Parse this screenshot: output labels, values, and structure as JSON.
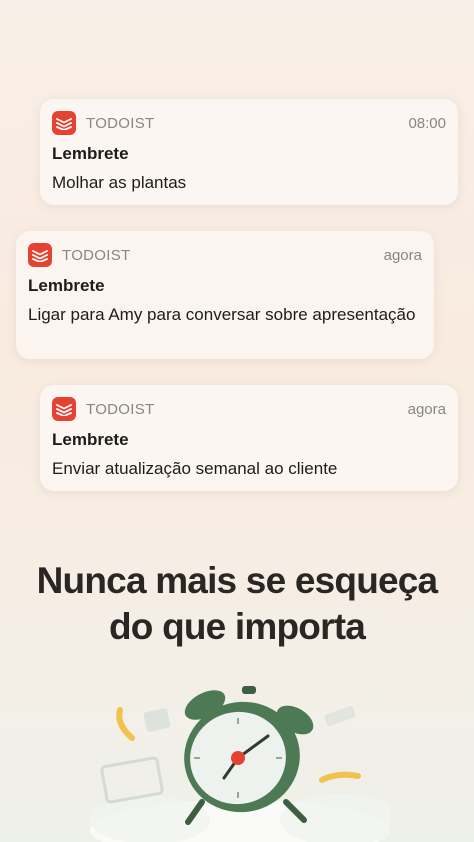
{
  "notifications": [
    {
      "app": "TODOIST",
      "time": "08:00",
      "title": "Lembrete",
      "body": "Molhar as plantas"
    },
    {
      "app": "TODOIST",
      "time": "agora",
      "title": "Lembrete",
      "body": "Ligar para Amy para conversar sobre apresentação"
    },
    {
      "app": "TODOIST",
      "time": "agora",
      "title": "Lembrete",
      "body": "Enviar atualização semanal ao cliente"
    }
  ],
  "headline": {
    "line1": "Nunca mais se esqueça",
    "line2": "do que importa"
  },
  "colors": {
    "brand": "#e44332",
    "clock": "#4d7a55",
    "accent_yellow": "#f2c14e"
  }
}
